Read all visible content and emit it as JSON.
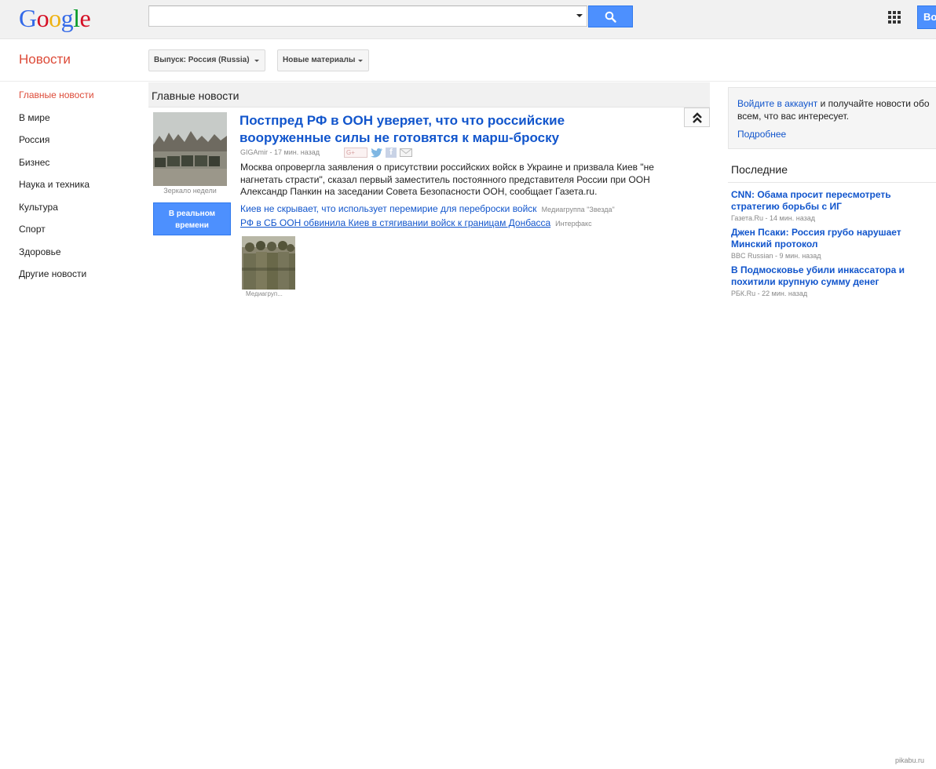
{
  "header": {
    "logo_letters": [
      {
        "ch": "G",
        "color": "#3369e8"
      },
      {
        "ch": "o",
        "color": "#d50f25"
      },
      {
        "ch": "o",
        "color": "#eeb211"
      },
      {
        "ch": "g",
        "color": "#3369e8"
      },
      {
        "ch": "l",
        "color": "#009925"
      },
      {
        "ch": "e",
        "color": "#d50f25"
      }
    ],
    "search_value": "",
    "search_icon": "magnifier-icon",
    "apps_icon": "apps-grid-icon",
    "signin_label": "Во"
  },
  "toolbar": {
    "section_title": "Новости",
    "edition_label": "Выпуск: Россия (Russia)",
    "sort_label": "Новые материалы"
  },
  "nav": {
    "items": [
      {
        "label": "Главные новости",
        "active": true
      },
      {
        "label": "В мире"
      },
      {
        "label": "Россия"
      },
      {
        "label": "Бизнес"
      },
      {
        "label": "Наука и техника"
      },
      {
        "label": "Культура"
      },
      {
        "label": "Спорт"
      },
      {
        "label": "Здоровье"
      },
      {
        "label": "Другие новости"
      }
    ]
  },
  "main": {
    "heading": "Главные новости",
    "story": {
      "title": "Постпред РФ в ООН уверяет, что что российские вооруженные силы не готовятся к марш-броску",
      "source": "GIGAmir",
      "time": "17 мин. назад",
      "meta": "GIGAmir - 17 мин. назад",
      "thumb_caption": "Зеркало недели",
      "realtime_label": "В реальном времени",
      "snippet": "Москва опровергла заявления о присутствии российских войск в Украине и призвала Киев \"не нагнетать страсти\", сказал первый заместитель постоянного представителя России при ООН Александр Панкин на заседании Совета Безопасности ООН, сообщает Газета.ru.",
      "related": [
        {
          "title": "Киев не скрывает, что использует перемирие для переброски войск",
          "source": "Медиагруппа \"Звезда\""
        },
        {
          "title": "РФ в СБ ООН обвинила Киев в стягивании войск к границам Донбасса",
          "source": "Интерфакс"
        }
      ],
      "small_thumb_caption": "Медиагруп...",
      "share_gplus_label": "G+"
    }
  },
  "sidebar": {
    "signin_link": "Войдите в аккаунт",
    "signin_rest": " и получайте новости обо всем, что вас интересует.",
    "more_label": "Подробнее",
    "latest_title": "Последние",
    "latest": [
      {
        "title": "CNN: Обама просит пересмотреть стратегию борьбы с ИГ",
        "meta": "Газета.Ru - 14 мин. назад"
      },
      {
        "title": "Джен Псаки: Россия грубо нарушает Минский протокол",
        "meta": "BBC Russian - 9 мин. назад"
      },
      {
        "title": "В Подмосковье убили инкассатора и похитили крупную сумму денег",
        "meta": "РБК.Ru - 22 мин. назад"
      }
    ]
  },
  "watermark": "pikabu.ru",
  "colors": {
    "accent_red": "#dd4b39",
    "link_blue": "#1155cc",
    "button_blue": "#4d90fe"
  }
}
